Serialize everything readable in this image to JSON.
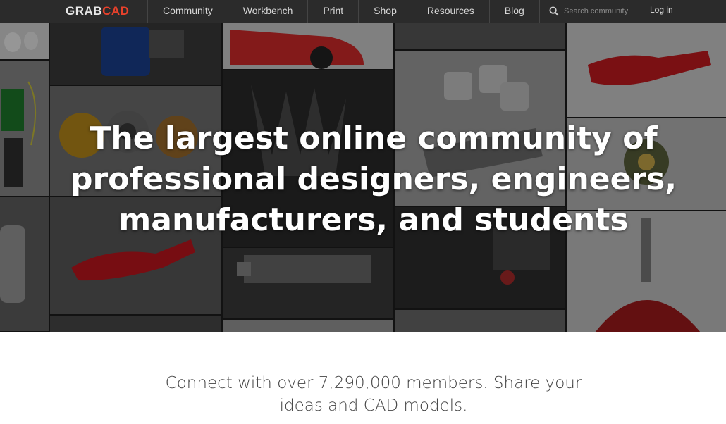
{
  "brand": {
    "grab": "GRAB",
    "cad": "CAD"
  },
  "nav": {
    "items": [
      {
        "label": "Community"
      },
      {
        "label": "Workbench"
      },
      {
        "label": "Print"
      },
      {
        "label": "Shop"
      },
      {
        "label": "Resources"
      },
      {
        "label": "Blog"
      }
    ],
    "search_placeholder": "Search community",
    "login_label": "Log in"
  },
  "hero": {
    "title": "The largest online community of professional designers, engineers, manufacturers, and students"
  },
  "tagline": "Connect with over 7,290,000 members. Share your ideas and CAD models.",
  "colors": {
    "nav_bg": "#2b2b2b",
    "brand_accent": "#e8412b",
    "hero_text": "#ffffff",
    "tagline_text": "#444444"
  },
  "icons": {
    "search": "search-icon"
  }
}
